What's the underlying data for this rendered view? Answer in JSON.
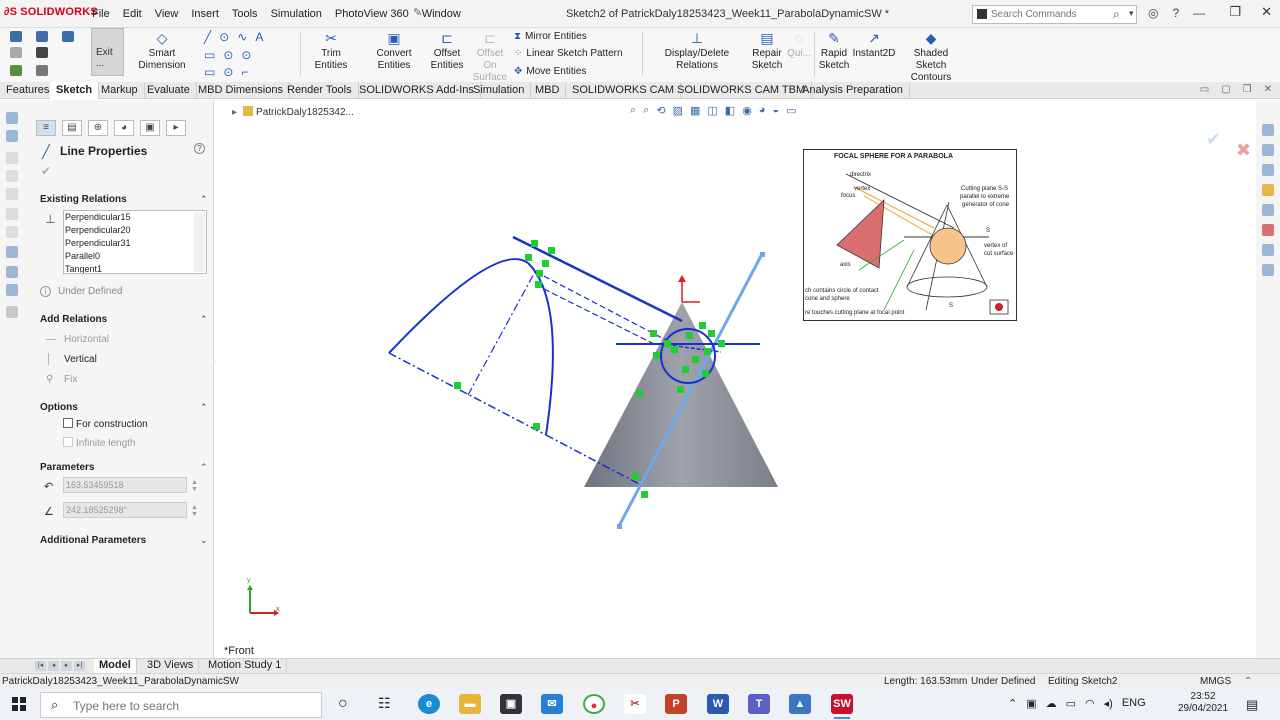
{
  "app": {
    "brand": "SOLIDWORKS",
    "doc_title": "Sketch2 of PatrickDaly18253423_Week11_ParabolaDynamicSW *"
  },
  "menu": [
    "File",
    "Edit",
    "View",
    "Insert",
    "Tools",
    "Simulation",
    "PhotoView 360",
    "Window"
  ],
  "search": {
    "placeholder": "Search Commands"
  },
  "toolbar": {
    "exit_label": "Exit ...",
    "smart_dimension": "Smart Dimension",
    "trim_entities": "Trim Entities",
    "convert_entities": "Convert Entities",
    "offset_entities": "Offset Entities",
    "offset_on_surface": "Offset On Surface",
    "mirror_entities": "Mirror Entities",
    "linear_sketch_pattern": "Linear Sketch Pattern",
    "move_entities": "Move Entities",
    "display_delete_relations": "Display/Delete Relations",
    "repair_sketch": "Repair Sketch",
    "quick_snaps": "Qui...",
    "rapid_sketch": "Rapid Sketch",
    "instant2d": "Instant2D",
    "shaded_sketch_contours": "Shaded Sketch Contours"
  },
  "tabs": [
    "Features",
    "Sketch",
    "Markup",
    "Evaluate",
    "MBD Dimensions",
    "Render Tools",
    "SOLIDWORKS Add-Ins",
    "Simulation",
    "MBD",
    "SOLIDWORKS CAM",
    "SOLIDWORKS CAM TBM",
    "Analysis Preparation"
  ],
  "active_tab": "Sketch",
  "property_manager": {
    "title": "Line Properties",
    "existing_relations_label": "Existing Relations",
    "relations": [
      "Perpendicular15",
      "Perpendicular20",
      "Perpendicular31",
      "Parallel0",
      "Tangent1"
    ],
    "status": "Under Defined",
    "add_relations_label": "Add Relations",
    "add_relations": [
      "Horizontal",
      "Vertical",
      "Fix"
    ],
    "options_label": "Options",
    "for_construction": "For construction",
    "infinite_length": "Infinite length",
    "parameters_label": "Parameters",
    "length_value": "163.53459518",
    "angle_value": "242.18525298°",
    "additional_parameters_label": "Additional Parameters"
  },
  "graphics": {
    "breadcrumb": "PatrickDaly1825342...",
    "view_name": "*Front",
    "triad_x": "x",
    "triad_y": "y",
    "reference_image": {
      "title": "FOCAL SPHERE FOR A PARABOLA",
      "labels": [
        "directrix",
        "vertex",
        "focus",
        "axis",
        "Cutting plane S-S",
        "parallel to extreme",
        "generator of cone",
        "S",
        "vertex of",
        "cut surface",
        "ch contains circle of contact",
        "cone and sphere",
        "re touches cutting plane at focal point",
        "S"
      ]
    }
  },
  "bottom_tabs": [
    "Model",
    "3D Views",
    "Motion Study 1"
  ],
  "status_bar": {
    "file": "PatrickDaly18253423_Week11_ParabolaDynamicSW",
    "length": "Length: 163.53mm",
    "state": "Under Defined",
    "editing": "Editing Sketch2",
    "units": "MMGS"
  },
  "taskbar": {
    "search_placeholder": "Type here to search",
    "language": "ENG",
    "time": "23:52",
    "date": "29/04/2021"
  },
  "colors": {
    "sketch_blue": "#1a2fd0",
    "relation_green": "#22cc33",
    "cone_gray": "#7b7f8a",
    "brand_red": "#d0021b"
  }
}
